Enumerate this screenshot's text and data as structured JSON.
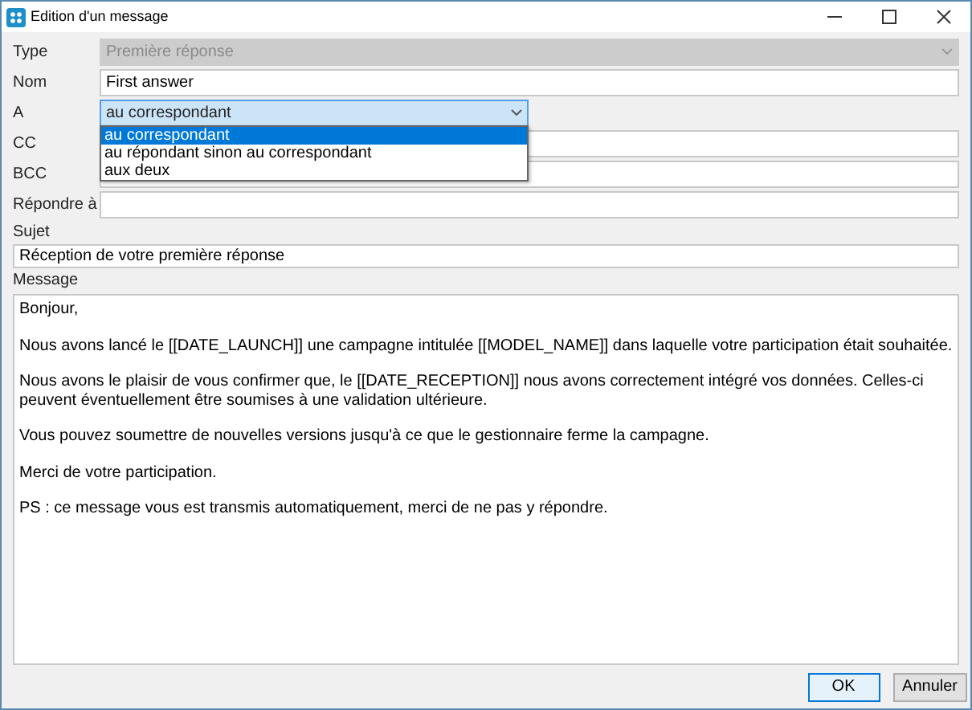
{
  "window": {
    "title": "Edition d'un message"
  },
  "fields": [
    {
      "kind": "select",
      "label": "Type",
      "value": "Première réponse",
      "disabled": true
    },
    {
      "kind": "text",
      "label": "Nom",
      "value": "First answer"
    },
    {
      "kind": "dropdown",
      "label": "A",
      "value": "au correspondant",
      "options": [
        {
          "label": "au correspondant",
          "selected": true
        },
        {
          "label": "au répondant sinon au correspondant",
          "selected": false
        },
        {
          "label": "aux deux",
          "selected": false
        }
      ]
    },
    {
      "kind": "text",
      "label": "CC"
    },
    {
      "kind": "text",
      "label": "BCC"
    },
    {
      "kind": "text",
      "label": "Répondre à"
    }
  ],
  "subject": {
    "label": "Sujet",
    "value": "Réception de votre première réponse"
  },
  "message": {
    "label": "Message",
    "paragraphs": [
      "Bonjour,",
      "Nous avons lancé le [[DATE_LAUNCH]] une campagne intitulée [[MODEL_NAME]] dans laquelle votre participation était souhaitée.",
      "Nous avons le plaisir de vous confirmer que, le [[DATE_RECEPTION]] nous avons correctement intégré vos données. Celles-ci peuvent éventuellement être soumises à une validation ultérieure.",
      "Vous pouvez soumettre de nouvelles versions jusqu'à ce que le gestionnaire ferme la campagne.",
      "Merci de votre participation.",
      "PS : ce message vous est transmis automatiquement, merci de ne pas y répondre."
    ]
  },
  "buttons": [
    {
      "label": "OK",
      "kind": "default"
    },
    {
      "label": "Annuler",
      "kind": "normal"
    }
  ]
}
